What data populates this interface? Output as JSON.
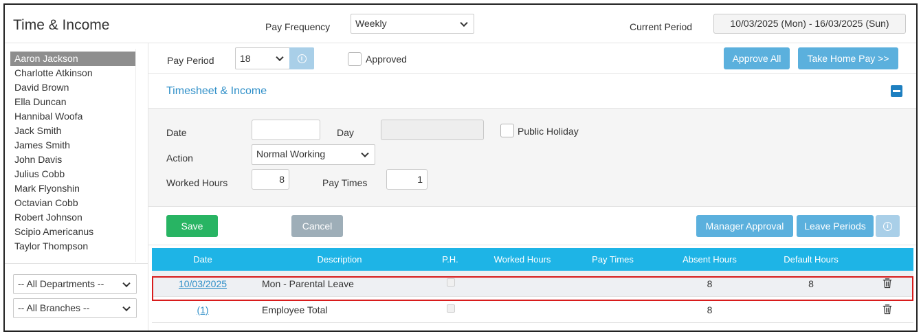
{
  "header": {
    "title": "Time & Income",
    "pay_frequency_label": "Pay Frequency",
    "pay_frequency_value": "Weekly",
    "current_period_label": "Current Period",
    "current_period_value": "10/03/2025 (Mon) - 16/03/2025 (Sun)"
  },
  "sidebar": {
    "employees": [
      {
        "name": "Aaron Jackson",
        "selected": true
      },
      {
        "name": "Charlotte Atkinson"
      },
      {
        "name": "David Brown"
      },
      {
        "name": "Ella Duncan"
      },
      {
        "name": "Hannibal Woofa"
      },
      {
        "name": "Jack Smith"
      },
      {
        "name": "James Smith"
      },
      {
        "name": "John Davis"
      },
      {
        "name": "Julius Cobb"
      },
      {
        "name": "Mark Flyonshin"
      },
      {
        "name": "Octavian Cobb"
      },
      {
        "name": "Robert Johnson"
      },
      {
        "name": "Scipio Americanus"
      },
      {
        "name": "Taylor Thompson"
      }
    ],
    "department_filter": "-- All Departments --",
    "branch_filter": "-- All Branches --"
  },
  "toolbar": {
    "pay_period_label": "Pay Period",
    "pay_period_value": "18",
    "approved_label": "Approved",
    "approve_all_label": "Approve All",
    "take_home_label": "Take Home Pay >>"
  },
  "section": {
    "title": "Timesheet & Income"
  },
  "form": {
    "date_label": "Date",
    "date_value": "",
    "day_label": "Day",
    "day_value": "",
    "public_holiday_label": "Public Holiday",
    "action_label": "Action",
    "action_value": "Normal Working",
    "worked_hours_label": "Worked Hours",
    "worked_hours_value": "8",
    "pay_times_label": "Pay Times",
    "pay_times_value": "1"
  },
  "actions": {
    "save_label": "Save",
    "cancel_label": "Cancel",
    "manager_approval_label": "Manager Approval",
    "leave_periods_label": "Leave Periods"
  },
  "table": {
    "columns": [
      "Date",
      "Description",
      "P.H.",
      "Worked Hours",
      "Pay Times",
      "Absent Hours",
      "Default Hours"
    ],
    "rows": [
      {
        "date": "10/03/2025",
        "description": "Mon - Parental Leave",
        "worked_hours": "",
        "pay_times": "",
        "absent_hours": "8",
        "default_hours": "8"
      },
      {
        "date": "(1)",
        "description": "Employee Total",
        "worked_hours": "",
        "pay_times": "",
        "absent_hours": "8",
        "default_hours": ""
      }
    ]
  },
  "colors": {
    "accent": "#1eb4e6",
    "primary_button": "#5bb0dd",
    "save_button": "#28b463",
    "highlight_border": "#d81c1c"
  },
  "icons": [
    "chevron-down-icon",
    "info-icon",
    "collapse-icon",
    "trash-icon"
  ]
}
